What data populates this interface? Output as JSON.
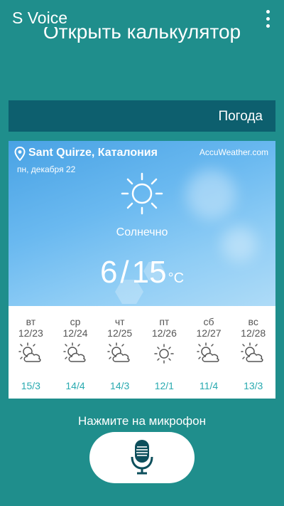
{
  "header": {
    "app_title": "S Voice",
    "menu_icon": "overflow-menu-icon"
  },
  "previous_command": "Открыть калькулятор",
  "section": {
    "title": "Погода"
  },
  "weather": {
    "location": "Sant Quirze, Каталония",
    "provider": "AccuWeather.com",
    "date": "пн, декабря 22",
    "condition": "Солнечно",
    "condition_icon": "sun-icon",
    "temp_high": "6",
    "temp_low": "15",
    "unit": "°C",
    "forecast": [
      {
        "day": "вт",
        "date": "12/23",
        "icon": "partly-cloudy-icon",
        "temps": "15/3"
      },
      {
        "day": "ср",
        "date": "12/24",
        "icon": "partly-cloudy-icon",
        "temps": "14/4"
      },
      {
        "day": "чт",
        "date": "12/25",
        "icon": "partly-cloudy-icon",
        "temps": "14/3"
      },
      {
        "day": "пт",
        "date": "12/26",
        "icon": "sun-icon",
        "temps": "12/1"
      },
      {
        "day": "сб",
        "date": "12/27",
        "icon": "partly-cloudy-icon",
        "temps": "11/4"
      },
      {
        "day": "вс",
        "date": "12/28",
        "icon": "partly-cloudy-icon",
        "temps": "13/3"
      }
    ]
  },
  "footer": {
    "prompt": "Нажмите на микрофон",
    "mic_icon": "microphone-icon"
  },
  "colors": {
    "background": "#1f8e8c",
    "band": "#0d5f6e",
    "accent": "#29aab0"
  }
}
